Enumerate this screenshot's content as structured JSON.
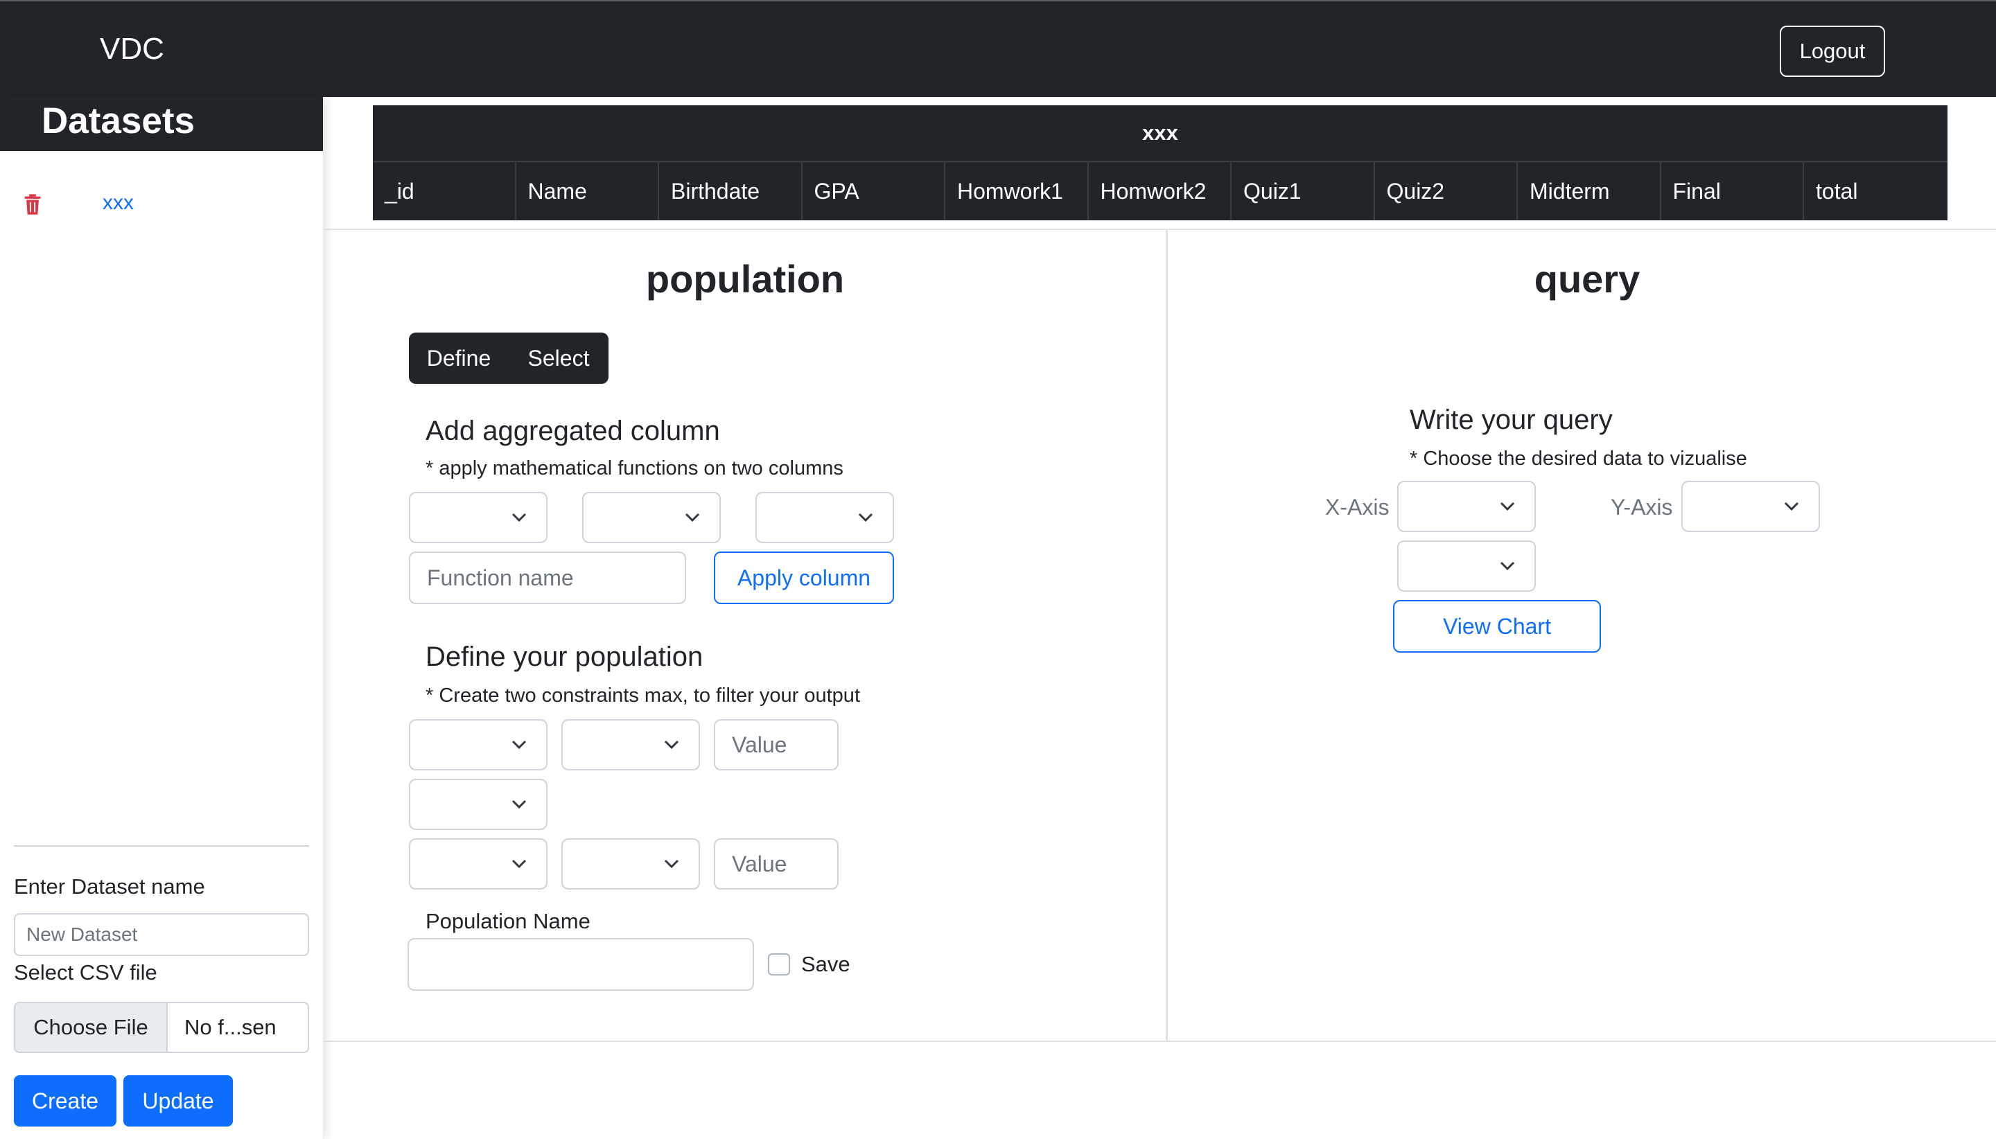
{
  "navbar": {
    "brand": "VDC",
    "logout_label": "Logout"
  },
  "sidebar": {
    "title": "Datasets",
    "datasets": [
      {
        "name": "xxx"
      }
    ],
    "dataset_name_label": "Enter Dataset name",
    "dataset_name_placeholder": "New Dataset",
    "csv_label": "Select CSV file",
    "choose_file_label": "Choose File",
    "file_name": "No f...sen",
    "create_label": "Create",
    "update_label": "Update"
  },
  "table": {
    "caption": "xxx",
    "columns": [
      "_id",
      "Name",
      "Birthdate",
      "GPA",
      "Homwork1",
      "Homwork2",
      "Quiz1",
      "Quiz2",
      "Midterm",
      "Final",
      "total"
    ]
  },
  "population": {
    "title": "population",
    "tabs": [
      "Define",
      "Select"
    ],
    "aggregated": {
      "heading": "Add aggregated column",
      "note": "* apply mathematical functions on two columns",
      "function_placeholder": "Function name",
      "apply_label": "Apply column"
    },
    "define": {
      "heading": "Define your population",
      "note": "* Create two constraints max, to filter your output",
      "value_placeholder": "Value"
    },
    "name_label": "Population Name",
    "save_label": "Save"
  },
  "query": {
    "title": "query",
    "heading": "Write your query",
    "note": "* Choose the desired data to vizualise",
    "x_axis_label": "X-Axis",
    "y_axis_label": "Y-Axis",
    "view_chart_label": "View Chart"
  },
  "colors": {
    "dark": "#212529",
    "primary": "#0d6efd",
    "danger": "#dc3545"
  },
  "icons": [
    "trash-icon",
    "chevron-down-icon"
  ]
}
